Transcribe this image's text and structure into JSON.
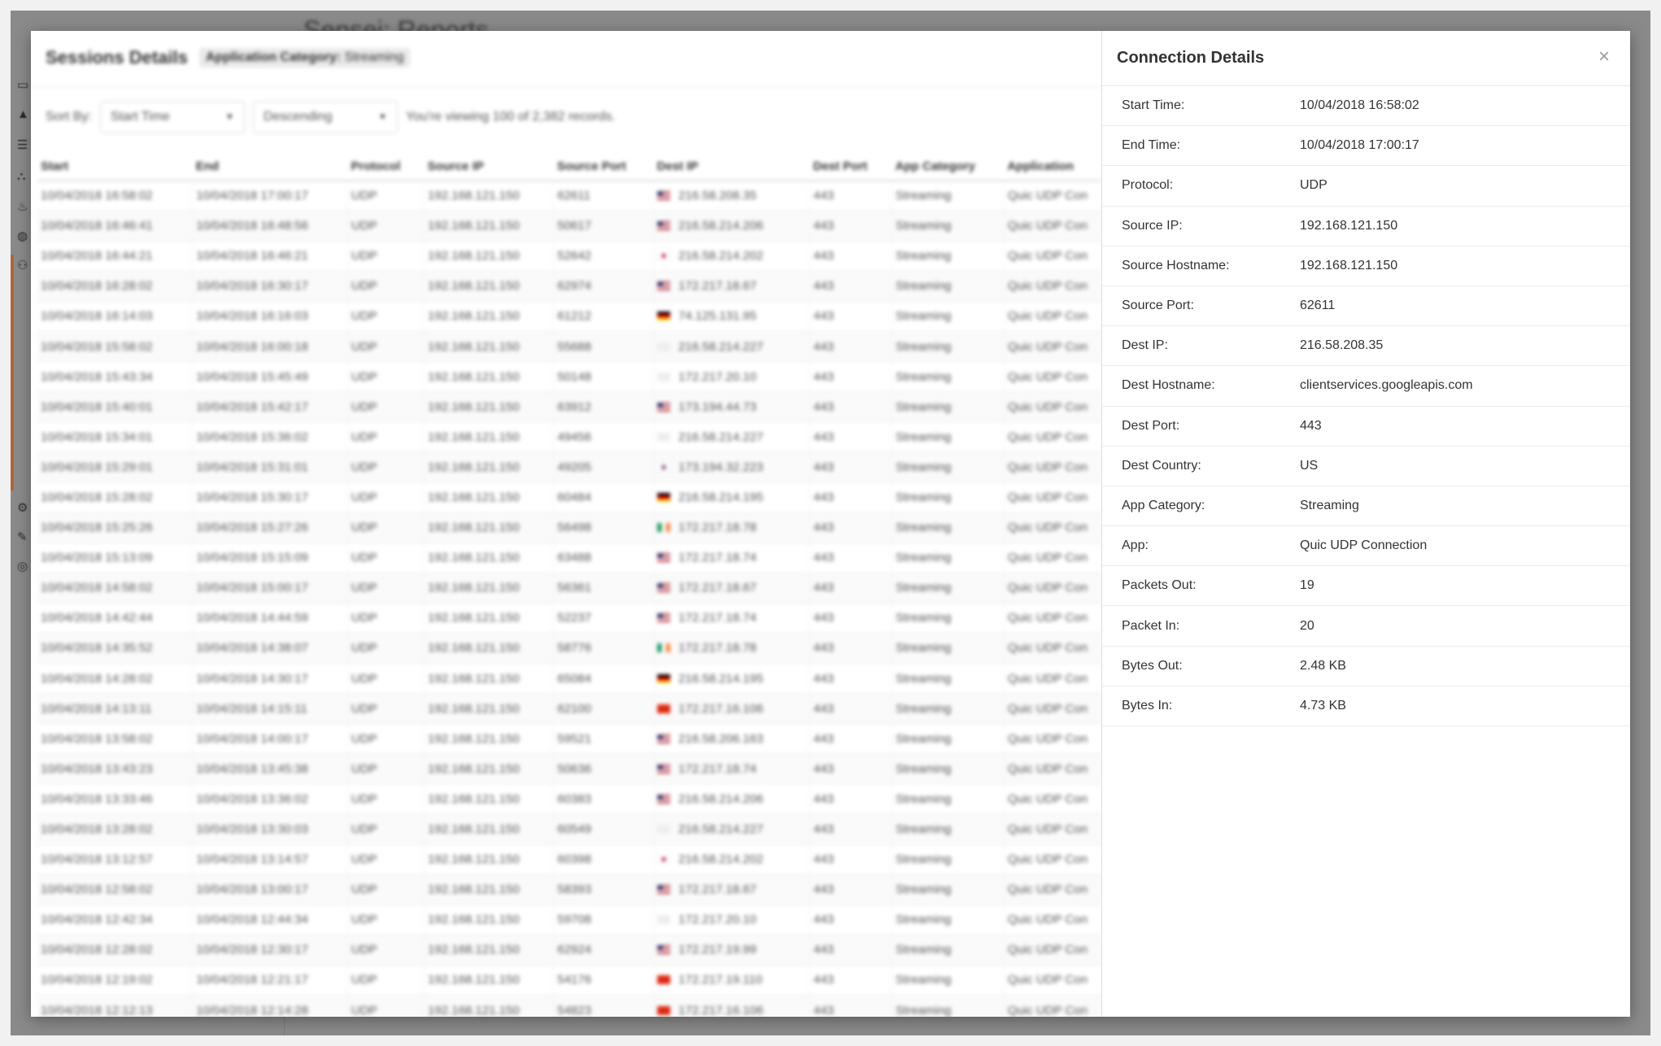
{
  "background": {
    "title": "Sensei: Reports"
  },
  "sessions": {
    "title": "Sessions Details",
    "filter_label": "Application Category:",
    "filter_value": "Streaming",
    "sort_by_label": "Sort By:",
    "sort_field": "Start Time",
    "sort_order": "Descending",
    "records_text": "You're viewing 100 of 2,382 records.",
    "columns": [
      "Start",
      "End",
      "Protocol",
      "Source IP",
      "Source Port",
      "Dest IP",
      "Dest Port",
      "App Category",
      "Application"
    ],
    "rows": [
      {
        "start": "10/04/2018 16:58:02",
        "end": "10/04/2018 17:00:17",
        "protocol": "UDP",
        "src_ip": "192.168.121.150",
        "src_port": "62611",
        "flag": "us",
        "dest_ip": "216.58.208.35",
        "dest_port": "443",
        "category": "Streaming",
        "app": "Quic UDP Con"
      },
      {
        "start": "10/04/2018 16:46:41",
        "end": "10/04/2018 16:48:56",
        "protocol": "UDP",
        "src_ip": "192.168.121.150",
        "src_port": "50617",
        "flag": "us",
        "dest_ip": "216.58.214.206",
        "dest_port": "443",
        "category": "Streaming",
        "app": "Quic UDP Con"
      },
      {
        "start": "10/04/2018 16:44:21",
        "end": "10/04/2018 16:46:21",
        "protocol": "UDP",
        "src_ip": "192.168.121.150",
        "src_port": "52642",
        "flag": "jp",
        "dest_ip": "216.58.214.202",
        "dest_port": "443",
        "category": "Streaming",
        "app": "Quic UDP Con"
      },
      {
        "start": "10/04/2018 16:28:02",
        "end": "10/04/2018 16:30:17",
        "protocol": "UDP",
        "src_ip": "192.168.121.150",
        "src_port": "62974",
        "flag": "us",
        "dest_ip": "172.217.18.67",
        "dest_port": "443",
        "category": "Streaming",
        "app": "Quic UDP Con"
      },
      {
        "start": "10/04/2018 16:14:03",
        "end": "10/04/2018 16:16:03",
        "protocol": "UDP",
        "src_ip": "192.168.121.150",
        "src_port": "61212",
        "flag": "de",
        "dest_ip": "74.125.131.95",
        "dest_port": "443",
        "category": "Streaming",
        "app": "Quic UDP Con"
      },
      {
        "start": "10/04/2018 15:58:02",
        "end": "10/04/2018 16:00:18",
        "protocol": "UDP",
        "src_ip": "192.168.121.150",
        "src_port": "55688",
        "flag": "none",
        "dest_ip": "216.58.214.227",
        "dest_port": "443",
        "category": "Streaming",
        "app": "Quic UDP Con"
      },
      {
        "start": "10/04/2018 15:43:34",
        "end": "10/04/2018 15:45:49",
        "protocol": "UDP",
        "src_ip": "192.168.121.150",
        "src_port": "50148",
        "flag": "none",
        "dest_ip": "172.217.20.10",
        "dest_port": "443",
        "category": "Streaming",
        "app": "Quic UDP Con"
      },
      {
        "start": "10/04/2018 15:40:01",
        "end": "10/04/2018 15:42:17",
        "protocol": "UDP",
        "src_ip": "192.168.121.150",
        "src_port": "63912",
        "flag": "us",
        "dest_ip": "173.194.44.73",
        "dest_port": "443",
        "category": "Streaming",
        "app": "Quic UDP Con"
      },
      {
        "start": "10/04/2018 15:34:01",
        "end": "10/04/2018 15:36:02",
        "protocol": "UDP",
        "src_ip": "192.168.121.150",
        "src_port": "49456",
        "flag": "none",
        "dest_ip": "216.58.214.227",
        "dest_port": "443",
        "category": "Streaming",
        "app": "Quic UDP Con"
      },
      {
        "start": "10/04/2018 15:29:01",
        "end": "10/04/2018 15:31:01",
        "protocol": "UDP",
        "src_ip": "192.168.121.150",
        "src_port": "49205",
        "flag": "kr",
        "dest_ip": "173.194.32.223",
        "dest_port": "443",
        "category": "Streaming",
        "app": "Quic UDP Con"
      },
      {
        "start": "10/04/2018 15:28:02",
        "end": "10/04/2018 15:30:17",
        "protocol": "UDP",
        "src_ip": "192.168.121.150",
        "src_port": "60484",
        "flag": "de",
        "dest_ip": "216.58.214.195",
        "dest_port": "443",
        "category": "Streaming",
        "app": "Quic UDP Con"
      },
      {
        "start": "10/04/2018 15:25:26",
        "end": "10/04/2018 15:27:26",
        "protocol": "UDP",
        "src_ip": "192.168.121.150",
        "src_port": "56498",
        "flag": "ie",
        "dest_ip": "172.217.18.78",
        "dest_port": "443",
        "category": "Streaming",
        "app": "Quic UDP Con"
      },
      {
        "start": "10/04/2018 15:13:09",
        "end": "10/04/2018 15:15:09",
        "protocol": "UDP",
        "src_ip": "192.168.121.150",
        "src_port": "63488",
        "flag": "us",
        "dest_ip": "172.217.18.74",
        "dest_port": "443",
        "category": "Streaming",
        "app": "Quic UDP Con"
      },
      {
        "start": "10/04/2018 14:58:02",
        "end": "10/04/2018 15:00:17",
        "protocol": "UDP",
        "src_ip": "192.168.121.150",
        "src_port": "56361",
        "flag": "us",
        "dest_ip": "172.217.18.67",
        "dest_port": "443",
        "category": "Streaming",
        "app": "Quic UDP Con"
      },
      {
        "start": "10/04/2018 14:42:44",
        "end": "10/04/2018 14:44:59",
        "protocol": "UDP",
        "src_ip": "192.168.121.150",
        "src_port": "52237",
        "flag": "us",
        "dest_ip": "172.217.18.74",
        "dest_port": "443",
        "category": "Streaming",
        "app": "Quic UDP Con"
      },
      {
        "start": "10/04/2018 14:35:52",
        "end": "10/04/2018 14:38:07",
        "protocol": "UDP",
        "src_ip": "192.168.121.150",
        "src_port": "58776",
        "flag": "ie",
        "dest_ip": "172.217.18.78",
        "dest_port": "443",
        "category": "Streaming",
        "app": "Quic UDP Con"
      },
      {
        "start": "10/04/2018 14:28:02",
        "end": "10/04/2018 14:30:17",
        "protocol": "UDP",
        "src_ip": "192.168.121.150",
        "src_port": "65084",
        "flag": "de",
        "dest_ip": "216.58.214.195",
        "dest_port": "443",
        "category": "Streaming",
        "app": "Quic UDP Con"
      },
      {
        "start": "10/04/2018 14:13:11",
        "end": "10/04/2018 14:15:11",
        "protocol": "UDP",
        "src_ip": "192.168.121.150",
        "src_port": "62100",
        "flag": "cn",
        "dest_ip": "172.217.16.106",
        "dest_port": "443",
        "category": "Streaming",
        "app": "Quic UDP Con"
      },
      {
        "start": "10/04/2018 13:58:02",
        "end": "10/04/2018 14:00:17",
        "protocol": "UDP",
        "src_ip": "192.168.121.150",
        "src_port": "59521",
        "flag": "us",
        "dest_ip": "216.58.206.163",
        "dest_port": "443",
        "category": "Streaming",
        "app": "Quic UDP Con"
      },
      {
        "start": "10/04/2018 13:43:23",
        "end": "10/04/2018 13:45:38",
        "protocol": "UDP",
        "src_ip": "192.168.121.150",
        "src_port": "50636",
        "flag": "us",
        "dest_ip": "172.217.18.74",
        "dest_port": "443",
        "category": "Streaming",
        "app": "Quic UDP Con"
      },
      {
        "start": "10/04/2018 13:33:46",
        "end": "10/04/2018 13:36:02",
        "protocol": "UDP",
        "src_ip": "192.168.121.150",
        "src_port": "60383",
        "flag": "us",
        "dest_ip": "216.58.214.206",
        "dest_port": "443",
        "category": "Streaming",
        "app": "Quic UDP Con"
      },
      {
        "start": "10/04/2018 13:28:02",
        "end": "10/04/2018 13:30:03",
        "protocol": "UDP",
        "src_ip": "192.168.121.150",
        "src_port": "60549",
        "flag": "none",
        "dest_ip": "216.58.214.227",
        "dest_port": "443",
        "category": "Streaming",
        "app": "Quic UDP Con"
      },
      {
        "start": "10/04/2018 13:12:57",
        "end": "10/04/2018 13:14:57",
        "protocol": "UDP",
        "src_ip": "192.168.121.150",
        "src_port": "60398",
        "flag": "jp",
        "dest_ip": "216.58.214.202",
        "dest_port": "443",
        "category": "Streaming",
        "app": "Quic UDP Con"
      },
      {
        "start": "10/04/2018 12:58:02",
        "end": "10/04/2018 13:00:17",
        "protocol": "UDP",
        "src_ip": "192.168.121.150",
        "src_port": "58393",
        "flag": "us",
        "dest_ip": "172.217.18.67",
        "dest_port": "443",
        "category": "Streaming",
        "app": "Quic UDP Con"
      },
      {
        "start": "10/04/2018 12:42:34",
        "end": "10/04/2018 12:44:34",
        "protocol": "UDP",
        "src_ip": "192.168.121.150",
        "src_port": "59708",
        "flag": "none",
        "dest_ip": "172.217.20.10",
        "dest_port": "443",
        "category": "Streaming",
        "app": "Quic UDP Con"
      },
      {
        "start": "10/04/2018 12:28:02",
        "end": "10/04/2018 12:30:17",
        "protocol": "UDP",
        "src_ip": "192.168.121.150",
        "src_port": "62924",
        "flag": "us",
        "dest_ip": "172.217.19.99",
        "dest_port": "443",
        "category": "Streaming",
        "app": "Quic UDP Con"
      },
      {
        "start": "10/04/2018 12:19:02",
        "end": "10/04/2018 12:21:17",
        "protocol": "UDP",
        "src_ip": "192.168.121.150",
        "src_port": "54176",
        "flag": "cn",
        "dest_ip": "172.217.19.110",
        "dest_port": "443",
        "category": "Streaming",
        "app": "Quic UDP Con"
      },
      {
        "start": "10/04/2018 12:12:13",
        "end": "10/04/2018 12:14:28",
        "protocol": "UDP",
        "src_ip": "192.168.121.150",
        "src_port": "54823",
        "flag": "cn",
        "dest_ip": "172.217.16.106",
        "dest_port": "443",
        "category": "Streaming",
        "app": "Quic UDP Con"
      }
    ]
  },
  "details": {
    "title": "Connection Details",
    "close_icon": "close-icon",
    "fields": [
      {
        "label": "Start Time:",
        "value": "10/04/2018 16:58:02"
      },
      {
        "label": "End Time:",
        "value": "10/04/2018 17:00:17"
      },
      {
        "label": "Protocol:",
        "value": "UDP"
      },
      {
        "label": "Source IP:",
        "value": "192.168.121.150"
      },
      {
        "label": "Source Hostname:",
        "value": "192.168.121.150"
      },
      {
        "label": "Source Port:",
        "value": "62611"
      },
      {
        "label": "Dest IP:",
        "value": "216.58.208.35"
      },
      {
        "label": "Dest Hostname:",
        "value": "clientservices.googleapis.com"
      },
      {
        "label": "Dest Port:",
        "value": "443"
      },
      {
        "label": "Dest Country:",
        "value": "US"
      },
      {
        "label": "App Category:",
        "value": "Streaming"
      },
      {
        "label": "App:",
        "value": "Quic UDP Connection"
      },
      {
        "label": "Packets Out:",
        "value": "19"
      },
      {
        "label": "Packet In:",
        "value": "20"
      },
      {
        "label": "Bytes Out:",
        "value": "2.48 KB"
      },
      {
        "label": "Bytes In:",
        "value": "4.73 KB"
      }
    ]
  }
}
